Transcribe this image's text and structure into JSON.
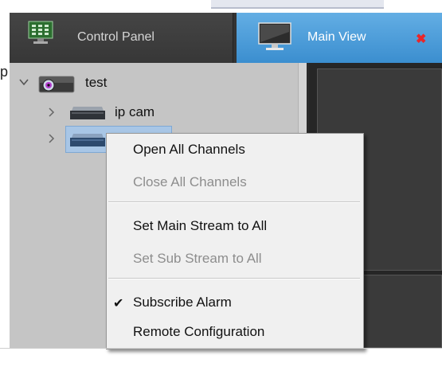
{
  "page_fragment": {
    "text": "p"
  },
  "tabs": [
    {
      "label": "Control Panel",
      "icon": "monitor-grid-icon",
      "active": false
    },
    {
      "label": "Main View",
      "icon": "monitor-icon",
      "active": true,
      "close_glyph": "✖"
    }
  ],
  "tree": {
    "root": {
      "label": "test",
      "icon": "camera-icon",
      "expanded": true
    },
    "children": [
      {
        "label": "ip cam",
        "icon": "nvr-device-icon"
      },
      {
        "label": "",
        "icon": "nvr-device-icon",
        "selected": true
      }
    ]
  },
  "context_menu": {
    "items": [
      {
        "label": "Open All Channels",
        "enabled": true
      },
      {
        "label": "Close All Channels",
        "enabled": false
      },
      {
        "label": "Set Main Stream to All",
        "enabled": true
      },
      {
        "label": "Set Sub Stream to All",
        "enabled": false
      },
      {
        "label": "Subscribe Alarm",
        "enabled": true,
        "checked": true
      },
      {
        "label": "Remote Configuration",
        "enabled": true
      }
    ]
  },
  "colors": {
    "active_tab": "#3b8ecf",
    "close_icon": "#e8262a",
    "selection": "#a8c6e6"
  }
}
